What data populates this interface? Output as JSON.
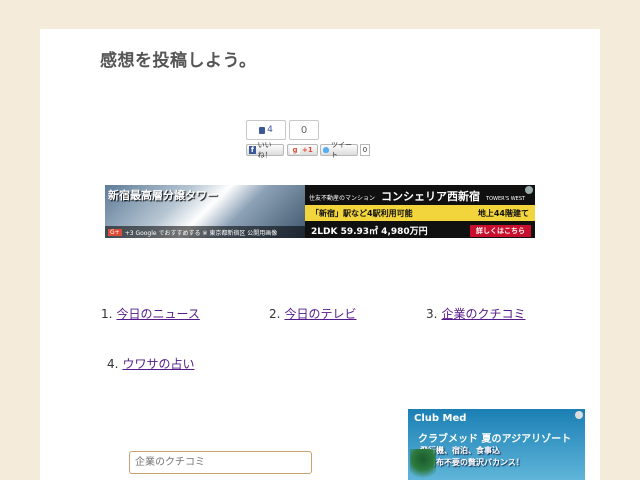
{
  "heading": "感想を投稿しよう。",
  "social": {
    "like_count": "4",
    "zero_count": "0",
    "fb_label": "いいね！",
    "gplus_label": "+1",
    "tweet_label": "ツイート",
    "tweet_count": "0"
  },
  "banner": {
    "left_title": "新宿最高層分譲タワー",
    "left_footer": "+3 Google でおすすめする ※ 東京都新宿区 公開用画像",
    "gplus_mini": "G+",
    "small_text": "住友不動産のマンション",
    "big_text": "コンシェリア西新宿",
    "tower_text": "TOWER'S WEST",
    "mid_left": "「新宿」駅など4駅利用可能",
    "mid_right": "地上44階建て",
    "price": "2LDK 59.93㎡ 4,980万円",
    "cta": "詳しくはこちら"
  },
  "links": [
    {
      "num": "1.",
      "label": "今日のニュース"
    },
    {
      "num": "2.",
      "label": "今日のテレビ"
    },
    {
      "num": "3.",
      "label": "企業のクチコミ"
    },
    {
      "num": "4.",
      "label": "ウワサの占い"
    }
  ],
  "clubmed": {
    "logo": "Club Med",
    "title": "クラブメッド 夏のアジアリゾート",
    "line1": "飛行機、宿泊、食事込",
    "line2": "お財布不要の贅沢バカンス！"
  },
  "search": {
    "placeholder": "企業のクチコミ"
  }
}
